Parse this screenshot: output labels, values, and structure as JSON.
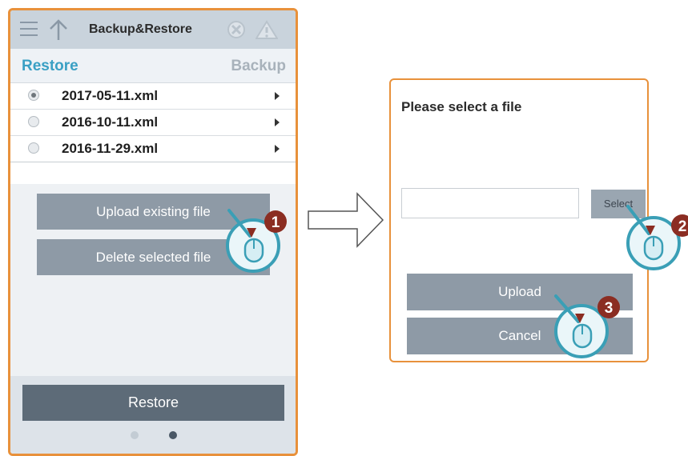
{
  "panel": {
    "header_title": "Backup&Restore",
    "tabs": [
      {
        "label": "Restore",
        "active": true
      },
      {
        "label": "Backup",
        "active": false
      }
    ],
    "files": [
      {
        "name": "2017-05-11.xml",
        "selected": true
      },
      {
        "name": "2016-10-11.xml",
        "selected": false
      },
      {
        "name": "2016-11-29.xml",
        "selected": false
      }
    ],
    "upload_existing_label": "Upload existing file",
    "delete_selected_label": "Delete selected file",
    "restore_label": "Restore",
    "page_indicator": {
      "total": 2,
      "current": 2
    }
  },
  "dialog": {
    "title": "Please select a file",
    "file_input_value": "",
    "select_label": "Select",
    "upload_label": "Upload",
    "cancel_label": "Cancel"
  },
  "steps": [
    "1",
    "2",
    "3"
  ],
  "colors": {
    "accent_border": "#e8913b",
    "tab_active": "#3aa0c4",
    "button_gray": "#8e9aa6",
    "button_dark": "#5d6b78",
    "step_badge": "#8b2d22",
    "cursor_ring": "#3a9fb6"
  },
  "icons": [
    "menu-icon",
    "up-arrow-icon",
    "gear-icon",
    "warning-icon",
    "chevron-right-icon",
    "mouse-cursor-icon",
    "flow-arrow-icon"
  ]
}
